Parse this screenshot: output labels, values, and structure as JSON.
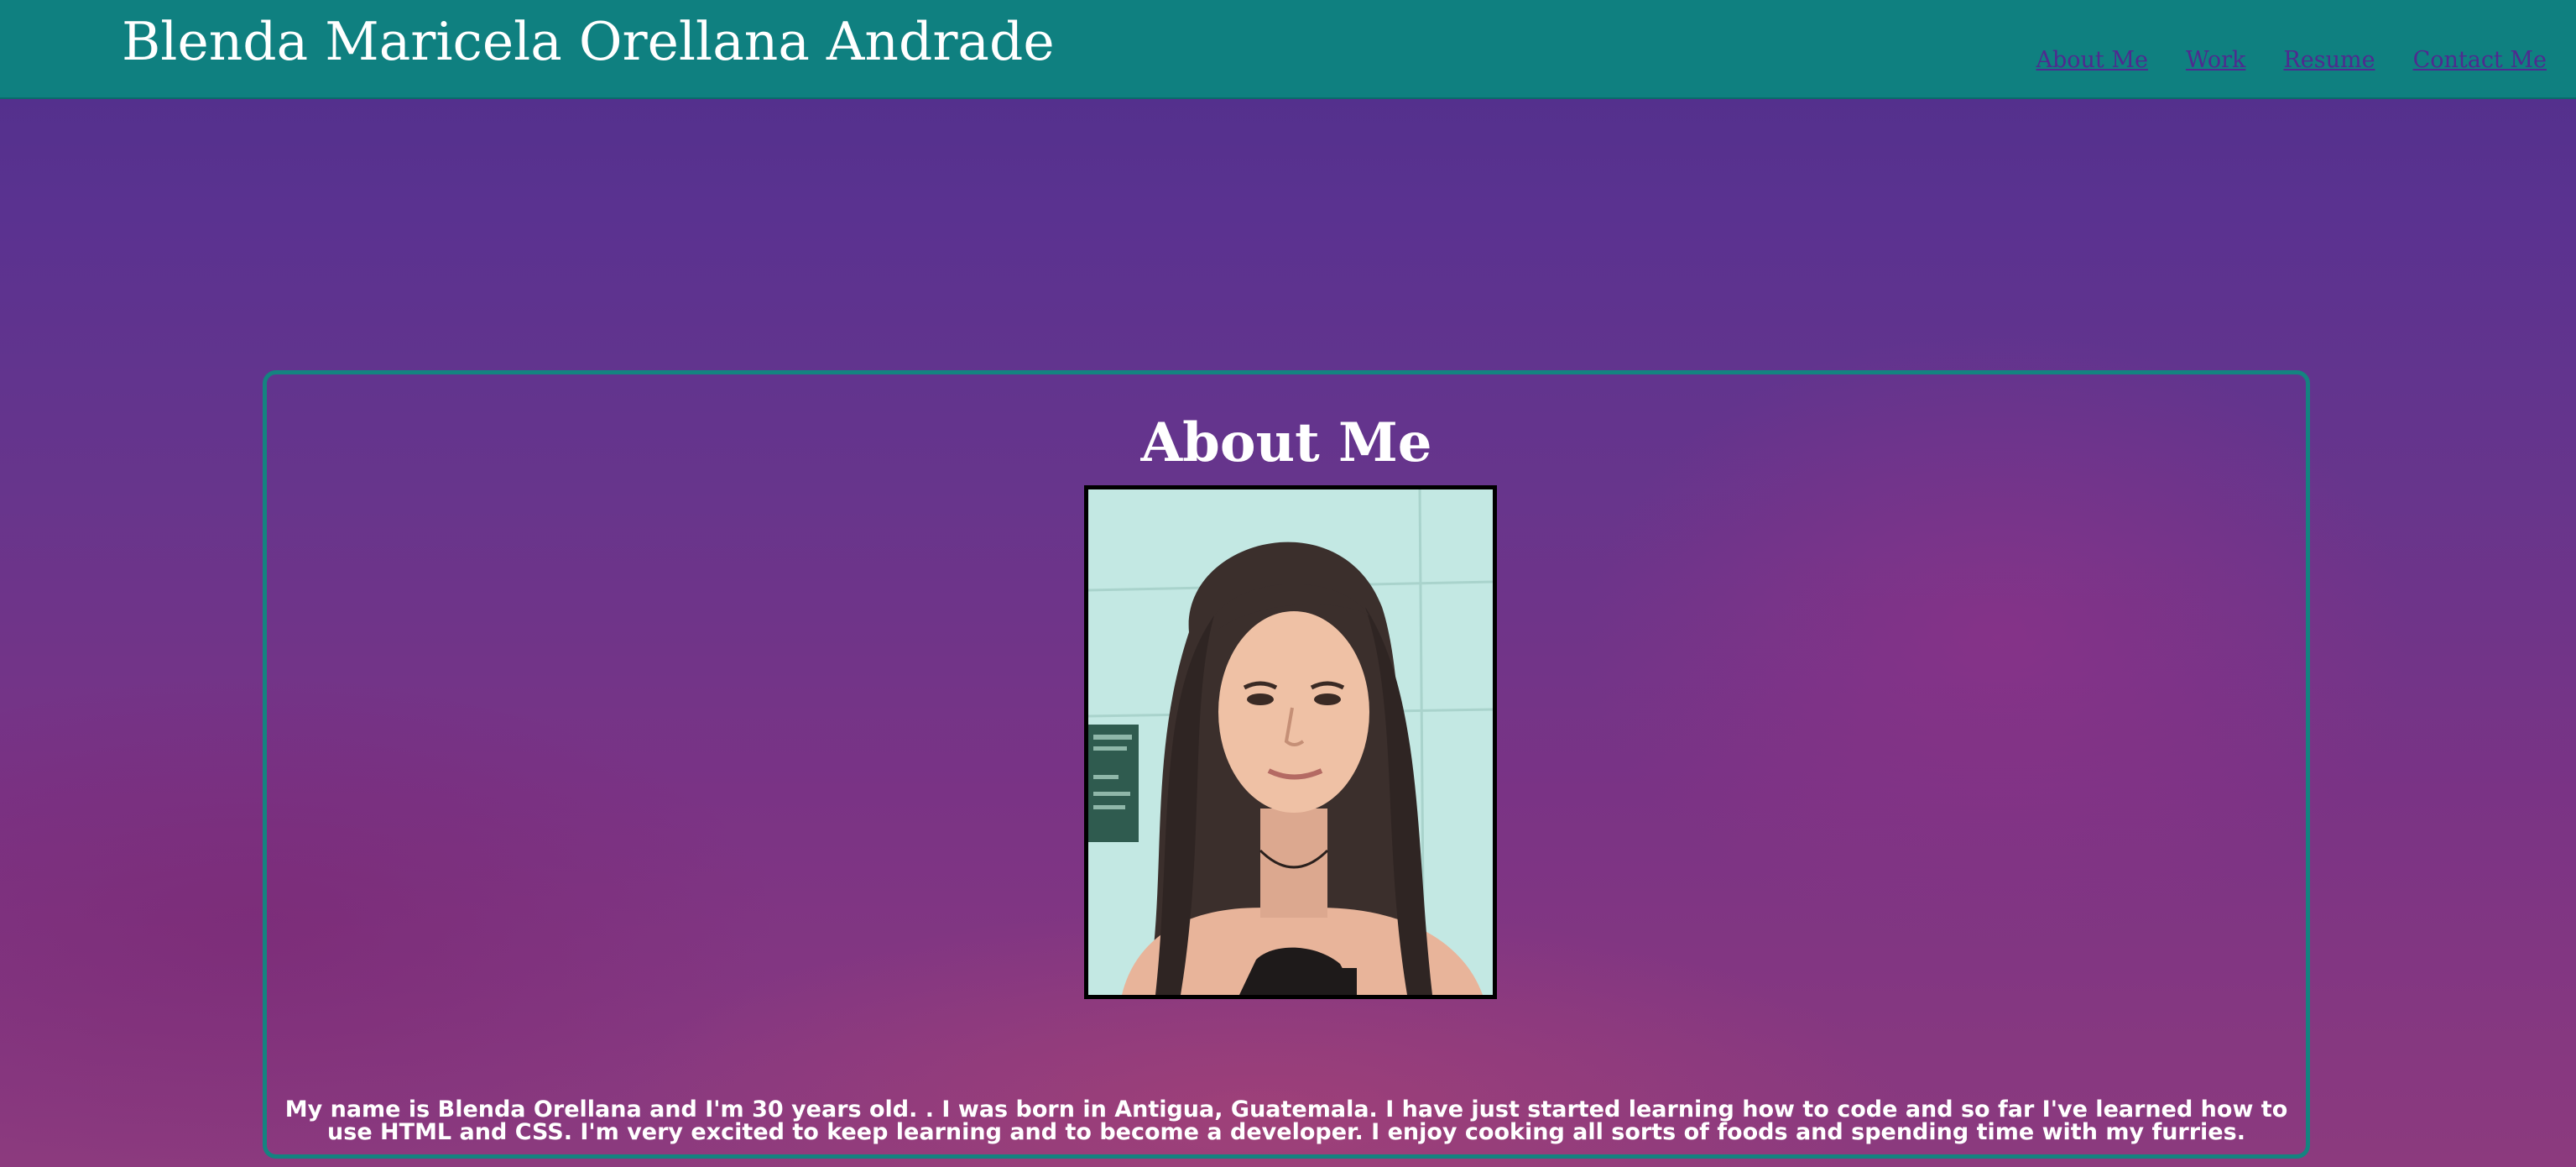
{
  "header": {
    "site_title": "Blenda Maricela Orellana Andrade",
    "nav": [
      {
        "label": "About Me"
      },
      {
        "label": "Work"
      },
      {
        "label": "Resume"
      },
      {
        "label": "Contact Me"
      }
    ]
  },
  "about": {
    "heading": "About Me",
    "photo_icon": "portrait-photo",
    "bio": "My name is Blenda Orellana and I'm 30 years old. . I was born in Antigua, Guatemala. I have just started learning how to code and so far I've learned how to use HTML and CSS. I'm very excited to keep learning and to become a developer. I enjoy cooking all sorts of foods and spending time with my furries."
  },
  "colors": {
    "header_bg": "#0f8080",
    "nav_link": "#4f2a8f",
    "box_border": "#148380",
    "page_bg": "#5e3290"
  }
}
